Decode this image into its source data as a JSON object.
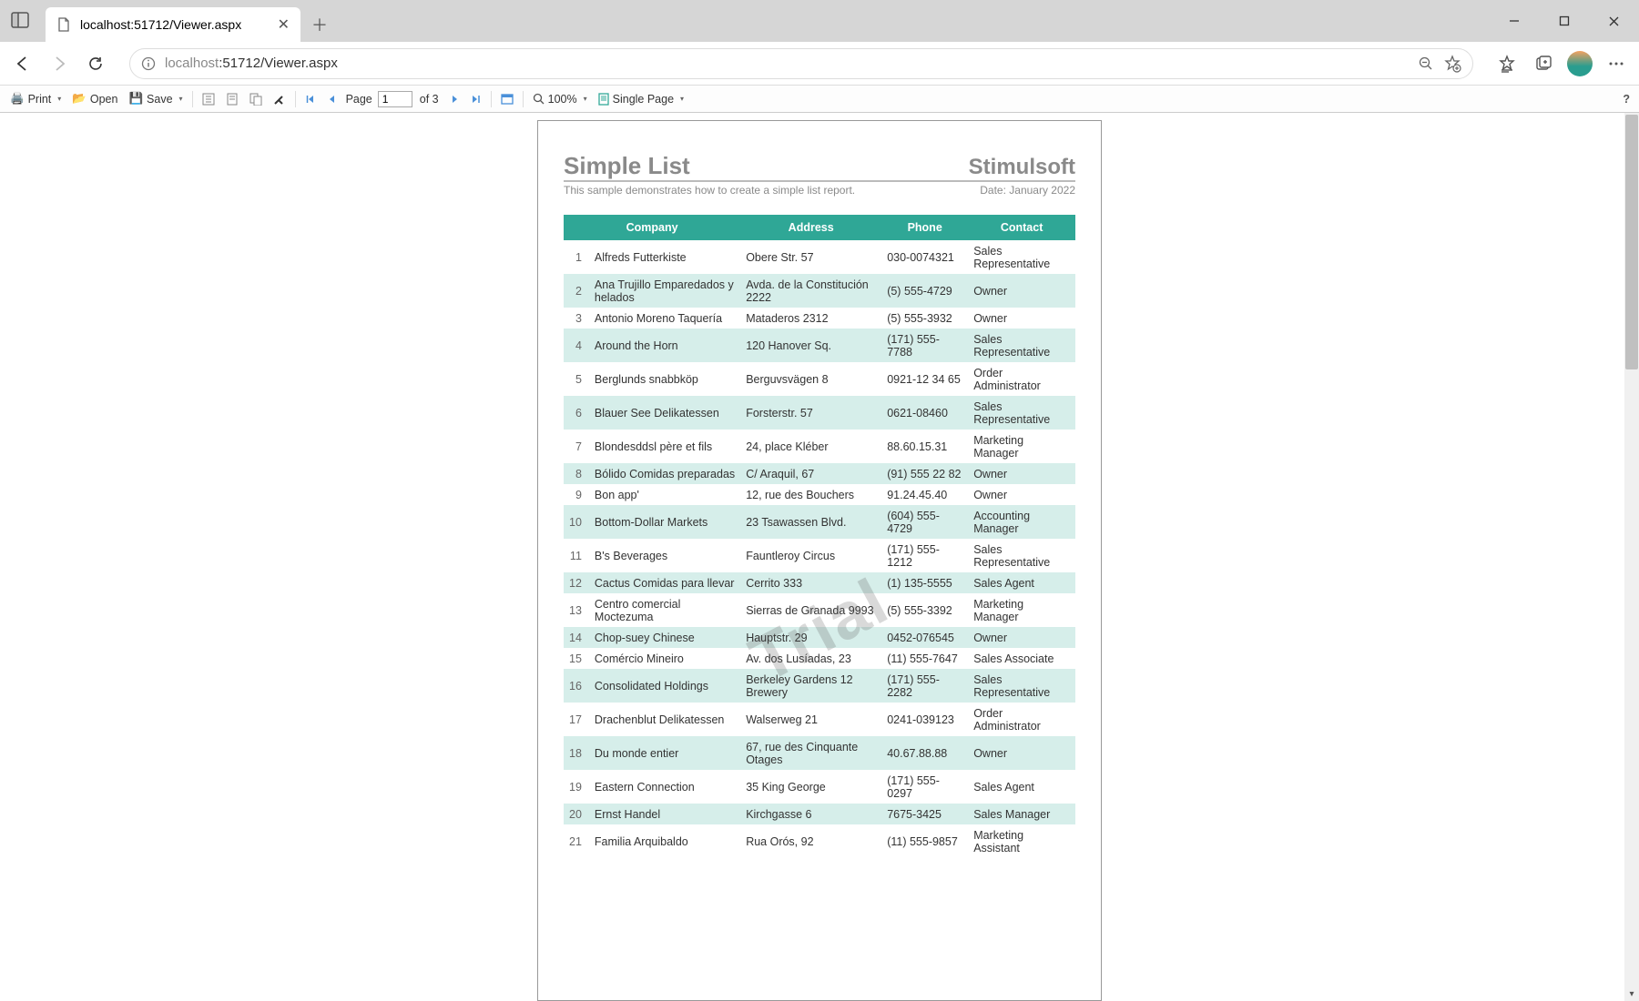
{
  "browser": {
    "tab_title": "localhost:51712/Viewer.aspx",
    "url_host": "localhost",
    "url_port_path": ":51712/Viewer.aspx"
  },
  "toolbar": {
    "print": "Print",
    "open": "Open",
    "save": "Save",
    "page_label": "Page",
    "page_current": "1",
    "page_of": "of 3",
    "zoom": "100%",
    "view_mode": "Single Page",
    "help": "?"
  },
  "report": {
    "title": "Simple List",
    "brand": "Stimulsoft",
    "subtitle": "This sample demonstrates how to create a simple list report.",
    "date": "Date: January 2022",
    "watermark": "Trial",
    "headers": {
      "company": "Company",
      "address": "Address",
      "phone": "Phone",
      "contact": "Contact"
    },
    "rows": [
      {
        "n": "1",
        "company": "Alfreds Futterkiste",
        "address": "Obere Str. 57",
        "phone": "030-0074321",
        "contact": "Sales Representative"
      },
      {
        "n": "2",
        "company": "Ana Trujillo Emparedados y helados",
        "address": "Avda. de la Constitución 2222",
        "phone": "(5) 555-4729",
        "contact": "Owner"
      },
      {
        "n": "3",
        "company": "Antonio Moreno Taquería",
        "address": "Mataderos  2312",
        "phone": "(5) 555-3932",
        "contact": "Owner"
      },
      {
        "n": "4",
        "company": "Around the Horn",
        "address": "120 Hanover Sq.",
        "phone": "(171) 555-7788",
        "contact": "Sales Representative"
      },
      {
        "n": "5",
        "company": "Berglunds snabbköp",
        "address": "Berguvsvägen  8",
        "phone": "0921-12 34 65",
        "contact": "Order Administrator"
      },
      {
        "n": "6",
        "company": "Blauer See Delikatessen",
        "address": "Forsterstr. 57",
        "phone": "0621-08460",
        "contact": "Sales Representative"
      },
      {
        "n": "7",
        "company": "Blondesddsl père et fils",
        "address": "24, place Kléber",
        "phone": "88.60.15.31",
        "contact": "Marketing Manager"
      },
      {
        "n": "8",
        "company": "Bólido Comidas preparadas",
        "address": "C/ Araquil, 67",
        "phone": "(91) 555 22 82",
        "contact": "Owner"
      },
      {
        "n": "9",
        "company": "Bon app'",
        "address": "12, rue des Bouchers",
        "phone": "91.24.45.40",
        "contact": "Owner"
      },
      {
        "n": "10",
        "company": "Bottom-Dollar Markets",
        "address": "23 Tsawassen Blvd.",
        "phone": "(604) 555-4729",
        "contact": "Accounting Manager"
      },
      {
        "n": "11",
        "company": "B's Beverages",
        "address": "Fauntleroy Circus",
        "phone": "(171) 555-1212",
        "contact": "Sales Representative"
      },
      {
        "n": "12",
        "company": "Cactus Comidas para llevar",
        "address": "Cerrito 333",
        "phone": "(1) 135-5555",
        "contact": "Sales Agent"
      },
      {
        "n": "13",
        "company": "Centro comercial Moctezuma",
        "address": "Sierras de Granada 9993",
        "phone": "(5) 555-3392",
        "contact": "Marketing Manager"
      },
      {
        "n": "14",
        "company": "Chop-suey Chinese",
        "address": "Hauptstr. 29",
        "phone": "0452-076545",
        "contact": "Owner"
      },
      {
        "n": "15",
        "company": "Comércio Mineiro",
        "address": "Av. dos Lusíadas, 23",
        "phone": "(11) 555-7647",
        "contact": "Sales Associate"
      },
      {
        "n": "16",
        "company": "Consolidated Holdings",
        "address": "Berkeley Gardens 12  Brewery",
        "phone": "(171) 555-2282",
        "contact": "Sales Representative"
      },
      {
        "n": "17",
        "company": "Drachenblut Delikatessen",
        "address": "Walserweg 21",
        "phone": "0241-039123",
        "contact": "Order Administrator"
      },
      {
        "n": "18",
        "company": "Du monde entier",
        "address": "67, rue des Cinquante Otages",
        "phone": "40.67.88.88",
        "contact": "Owner"
      },
      {
        "n": "19",
        "company": "Eastern Connection",
        "address": "35 King George",
        "phone": "(171) 555-0297",
        "contact": "Sales Agent"
      },
      {
        "n": "20",
        "company": "Ernst Handel",
        "address": "Kirchgasse 6",
        "phone": "7675-3425",
        "contact": "Sales Manager"
      },
      {
        "n": "21",
        "company": "Familia Arquibaldo",
        "address": "Rua Orós, 92",
        "phone": "(11) 555-9857",
        "contact": "Marketing Assistant"
      }
    ]
  }
}
